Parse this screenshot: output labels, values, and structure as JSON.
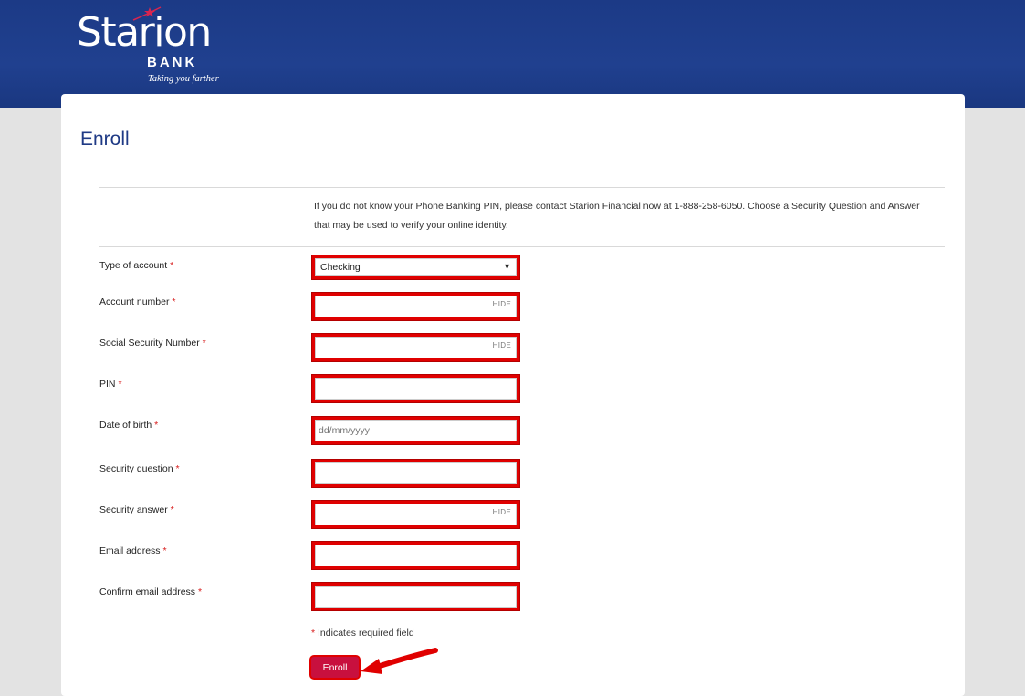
{
  "brand": {
    "name": "Starion",
    "sub": "BANK",
    "tagline": "Taking you farther",
    "colors": {
      "header": "#1f3d8c",
      "accent": "#c8103e",
      "highlight": "#e00000"
    }
  },
  "page": {
    "title": "Enroll",
    "intro": "If you do not know your Phone Banking PIN, please contact Starion Financial now at 1-888-258-6050. Choose a Security Question and Answer that may be used to verify your online identity."
  },
  "form": {
    "required_mark": "*",
    "hide_label": "HIDE",
    "account_type": {
      "label": "Type of account",
      "value": "Checking"
    },
    "account_number": {
      "label": "Account number"
    },
    "ssn": {
      "label": "Social Security Number"
    },
    "pin": {
      "label": "PIN"
    },
    "dob": {
      "label": "Date of birth",
      "placeholder": "dd/mm/yyyy"
    },
    "security_question": {
      "label": "Security question"
    },
    "security_answer": {
      "label": "Security answer"
    },
    "email": {
      "label": "Email address"
    },
    "confirm_email": {
      "label": "Confirm email address"
    },
    "required_note": "Indicates required field",
    "submit_label": "Enroll"
  }
}
